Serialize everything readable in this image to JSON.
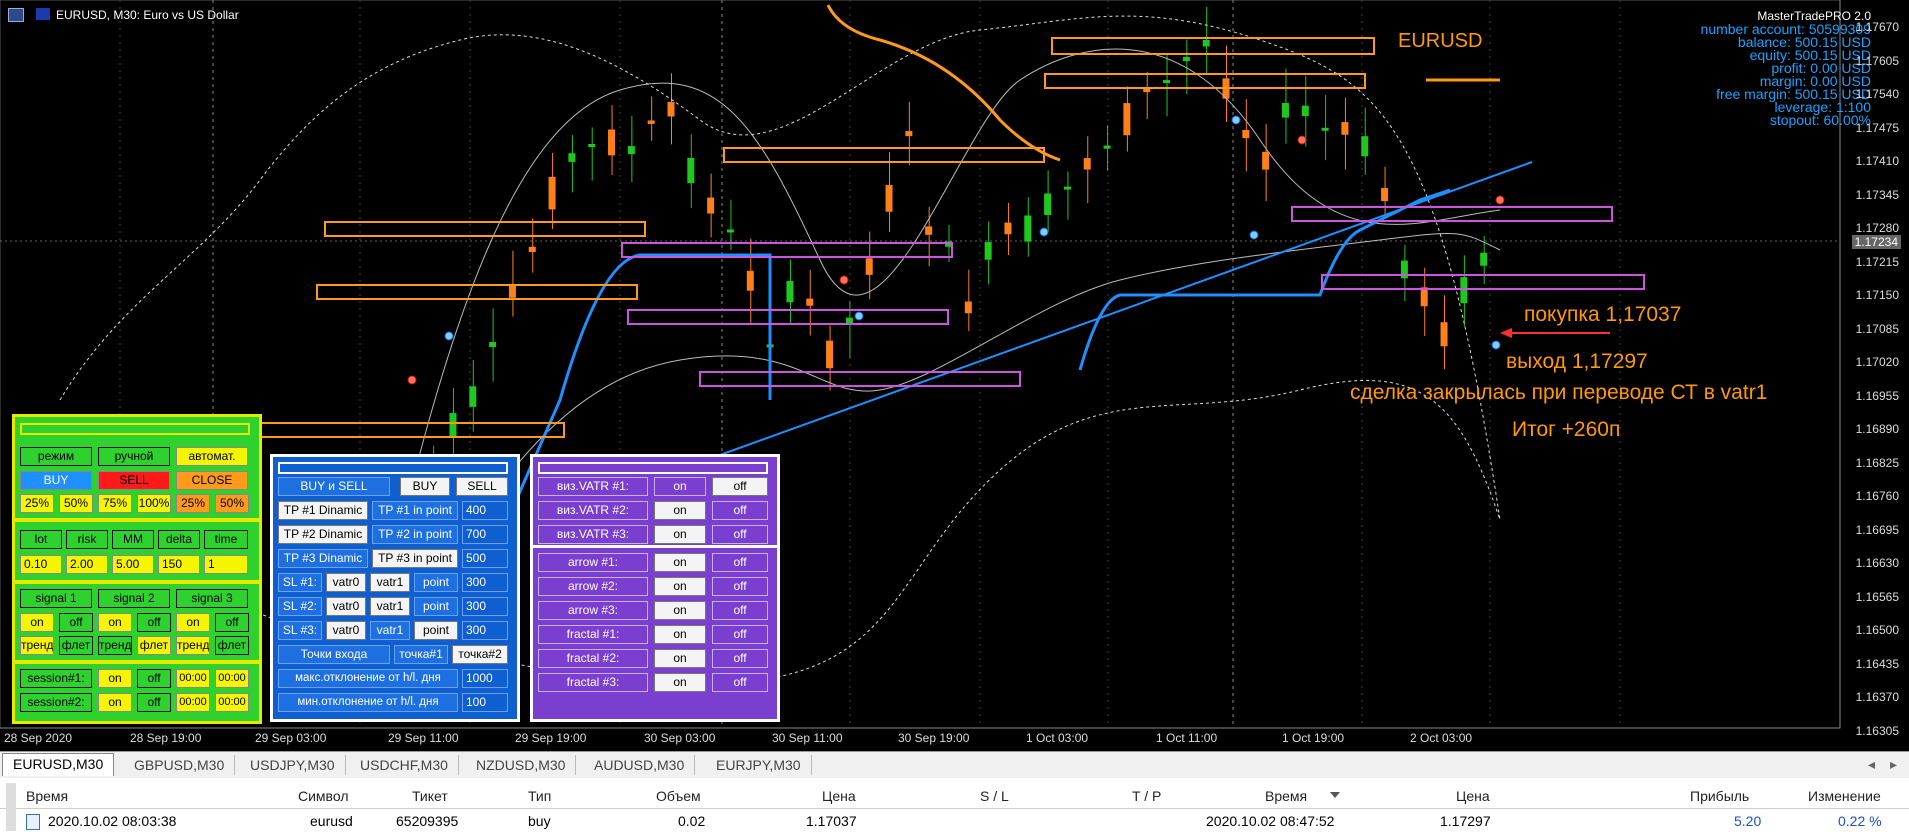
{
  "window": {
    "title": "EURUSD, M30:  Euro vs US Dollar",
    "symbol_label": "EURUSD"
  },
  "account": {
    "header": "MasterTradePRO 2.0",
    "lines": [
      "number account: 50599309",
      "balance: 500.15 USD",
      "equity: 500.15 USD",
      "profit: 0.00 USD",
      "margin: 0.00 USD",
      "free margin: 500.15 USD",
      "leverage: 1:100",
      "stopout: 60.00%"
    ]
  },
  "price_axis": {
    "levels": [
      "1.17670",
      "1.17605",
      "1.17540",
      "1.17475",
      "1.17410",
      "1.17345",
      "1.17280",
      "1.17215",
      "1.17150",
      "1.17085",
      "1.17020",
      "1.16955",
      "1.16890",
      "1.16825",
      "1.16760",
      "1.16695",
      "1.16630",
      "1.16565",
      "1.16500",
      "1.16435",
      "1.16370",
      "1.16305"
    ],
    "current": "1.17234"
  },
  "time_axis": [
    "28 Sep 2020",
    "28 Sep 19:00",
    "29 Sep 03:00",
    "29 Sep 11:00",
    "29 Sep 19:00",
    "30 Sep 03:00",
    "30 Sep 11:00",
    "30 Sep 19:00",
    "1 Oct 03:00",
    "1 Oct 11:00",
    "1 Oct 19:00",
    "2 Oct 03:00"
  ],
  "annotations": {
    "buy": "покупка 1,17037",
    "exit": "выход 1,17297",
    "note": "сделка закрылась при переводе СТ в vatr1",
    "total": "Итог +260п"
  },
  "panel1": {
    "mode": [
      "режим",
      "ручной",
      "автомат."
    ],
    "actions": [
      "BUY",
      "SELL",
      "CLOSE"
    ],
    "percents": [
      "25%",
      "50%",
      "75%",
      "100%",
      "25%",
      "50%"
    ],
    "params": [
      "lot",
      "risk",
      "MM",
      "delta",
      "time"
    ],
    "values": [
      "0.10",
      "2.00",
      "5.00",
      "150",
      "1"
    ],
    "signals": [
      "signal 1",
      "signal 2",
      "signal 3"
    ],
    "onoff": [
      "on",
      "off",
      "on",
      "off",
      "on",
      "off"
    ],
    "trend": [
      "тренд",
      "флет",
      "тренд",
      "флет",
      "тренд",
      "флет"
    ],
    "sessions": [
      {
        "label": "session#1:",
        "on": "on",
        "off": "off",
        "from": "00:00",
        "to": "00:00"
      },
      {
        "label": "session#2:",
        "on": "on",
        "off": "off",
        "from": "00:00",
        "to": "00:00"
      }
    ]
  },
  "panel2": {
    "top": [
      "BUY и SELL",
      "BUY",
      "SELL"
    ],
    "tp": [
      {
        "a": "TP #1 Dinamic",
        "b": "TP #1 in point",
        "v": "400"
      },
      {
        "a": "TP #2 Dinamic",
        "b": "TP #2 in point",
        "v": "700"
      },
      {
        "a": "TP #3 Dinamic",
        "b": "TP #3 in point",
        "v": "500"
      }
    ],
    "sl": [
      {
        "label": "SL #1:",
        "a": "vatr0",
        "b": "vatr1",
        "c": "point",
        "v": "300"
      },
      {
        "label": "SL #2:",
        "a": "vatr0",
        "b": "vatr1",
        "c": "point",
        "v": "300"
      },
      {
        "label": "SL #3:",
        "a": "vatr0",
        "b": "vatr1",
        "c": "point",
        "v": "300"
      }
    ],
    "entry": [
      "Точки входа",
      "точка#1",
      "точка#2"
    ],
    "max_dev": {
      "label": "макс.отклонение от h/l. дня",
      "value": "1000"
    },
    "min_dev": {
      "label": "мин.отклонение от h/l. дня",
      "value": "100"
    }
  },
  "panel3": {
    "rows": [
      {
        "label": "виз.VATR #1:",
        "on": "on",
        "off": "off"
      },
      {
        "label": "виз.VATR #2:",
        "on": "on",
        "off": "off"
      },
      {
        "label": "виз.VATR #3:",
        "on": "on",
        "off": "off"
      },
      {
        "label": "arrow #1:",
        "on": "on",
        "off": "off"
      },
      {
        "label": "arrow #2:",
        "on": "on",
        "off": "off"
      },
      {
        "label": "arrow #3:",
        "on": "on",
        "off": "off"
      },
      {
        "label": "fractal #1:",
        "on": "on",
        "off": "off"
      },
      {
        "label": "fractal #2:",
        "on": "on",
        "off": "off"
      },
      {
        "label": "fractal #3:",
        "on": "on",
        "off": "off"
      }
    ]
  },
  "tabs": [
    "EURUSD,M30",
    "GBPUSD,M30",
    "USDJPY,M30",
    "USDCHF,M30",
    "NZDUSD,M30",
    "AUDUSD,M30",
    "EURJPY,M30"
  ],
  "trades": {
    "headers": [
      "Время",
      "Символ",
      "Тикет",
      "Тип",
      "Объем",
      "Цена",
      "S / L",
      "T / P",
      "Время",
      "Цена",
      "Прибыль",
      "Изменение"
    ],
    "row": [
      "2020.10.02 08:03:38",
      "eurusd",
      "65209395",
      "buy",
      "0.02",
      "1.17037",
      "",
      "",
      "2020.10.02 08:47:52",
      "1.17297",
      "5.20",
      "0.22 %"
    ]
  }
}
